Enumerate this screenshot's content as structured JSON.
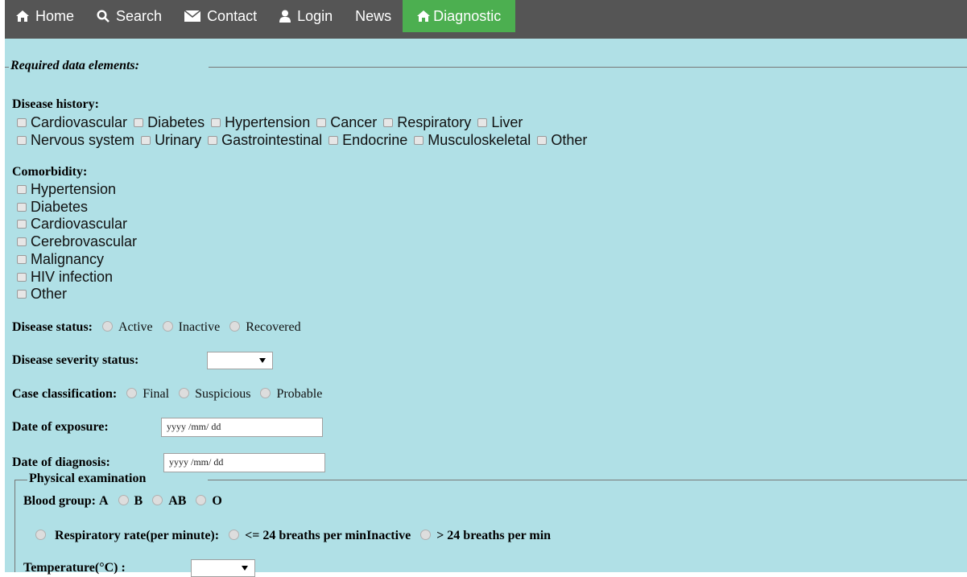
{
  "nav": [
    {
      "label": "Home",
      "icon": "home-icon"
    },
    {
      "label": "Search",
      "icon": "search-icon"
    },
    {
      "label": "Contact",
      "icon": "envelope-icon"
    },
    {
      "label": "Login",
      "icon": "user-icon"
    },
    {
      "label": "News",
      "icon": ""
    },
    {
      "label": "Diagnostic",
      "icon": "home-icon",
      "active": true
    }
  ],
  "colors": {
    "nav_bg": "#555555",
    "active_tab": "#4caf50",
    "content_bg": "#b0e0e6"
  },
  "form": {
    "legend": "Required data elements:",
    "disease_history": {
      "label": "Disease history:",
      "row1": [
        "Cardiovascular",
        "Diabetes",
        "Hypertension",
        "Cancer",
        "Respiratory",
        "Liver"
      ],
      "row2": [
        "Nervous system",
        "Urinary",
        "Gastrointestinal",
        "Endocrine",
        "Musculoskeletal",
        "Other"
      ]
    },
    "comorbidity": {
      "label": "Comorbidity:",
      "items": [
        "Hypertension",
        "Diabetes",
        "Cardiovascular",
        "Cerebrovascular",
        "Malignancy",
        "HIV infection",
        "Other"
      ]
    },
    "disease_status": {
      "label": "Disease status:",
      "options": [
        "Active",
        "Inactive",
        "Recovered"
      ]
    },
    "severity": {
      "label": "Disease severity status:",
      "value": ""
    },
    "case_class": {
      "label": "Case classification:",
      "options": [
        "Final",
        "Suspicious",
        "Probable"
      ]
    },
    "exposure": {
      "label": "Date of exposure:",
      "placeholder": "yyyy /mm/ dd"
    },
    "diagnosis": {
      "label": "Date of diagnosis:",
      "placeholder": "yyyy /mm/ dd"
    },
    "physical": {
      "legend": "Physical examination",
      "blood_group": {
        "label": "Blood group:",
        "options": [
          "A",
          "B",
          "AB",
          "O"
        ]
      },
      "resp": {
        "label": "Respiratory rate(per minute):",
        "options": [
          "<= 24 breaths per minInactive",
          "> 24 breaths per min"
        ]
      },
      "temperature": {
        "label": "Temperature(°C) :",
        "value": ""
      }
    }
  }
}
